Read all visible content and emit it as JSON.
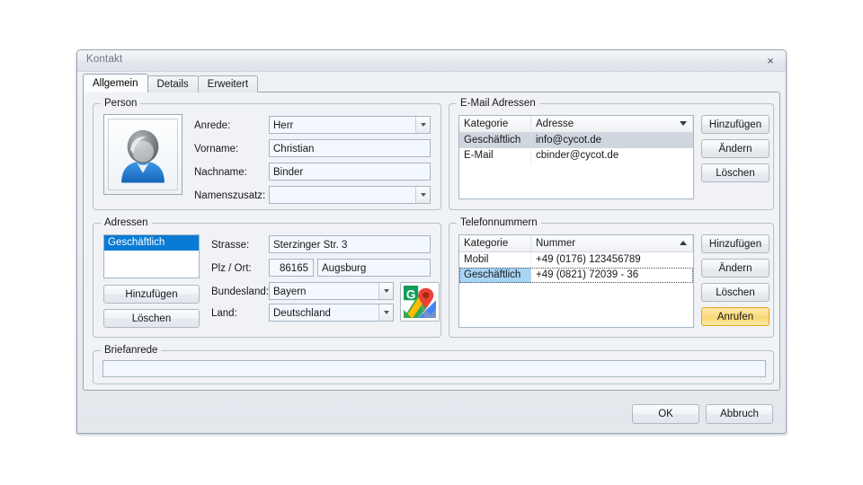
{
  "window": {
    "title": "Kontakt",
    "close_label": "×"
  },
  "tabs": [
    {
      "label": "Allgemein",
      "active": true
    },
    {
      "label": "Details",
      "active": false
    },
    {
      "label": "Erweitert",
      "active": false
    }
  ],
  "person": {
    "legend": "Person",
    "avatar_icon": "contact-avatar-icon",
    "fields": {
      "anrede_label": "Anrede:",
      "anrede_value": "Herr",
      "vorname_label": "Vorname:",
      "vorname_value": "Christian",
      "nachname_label": "Nachname:",
      "nachname_value": "Binder",
      "namenszusatz_label": "Namenszusatz:",
      "namenszusatz_value": ""
    }
  },
  "email": {
    "legend": "E-Mail Adressen",
    "columns": [
      "Kategorie",
      "Adresse"
    ],
    "sort": "desc",
    "rows": [
      {
        "kategorie": "Geschäftlich",
        "adresse": "info@cycot.de",
        "selected": "gray"
      },
      {
        "kategorie": "E-Mail",
        "adresse": "cbinder@cycot.de",
        "selected": "none"
      }
    ],
    "buttons": {
      "add": "Hinzufügen",
      "edit": "Ändern",
      "delete": "Löschen"
    }
  },
  "adressen": {
    "legend": "Adressen",
    "categories": [
      {
        "label": "Geschäftlich",
        "selected": true
      }
    ],
    "buttons": {
      "add": "Hinzufügen",
      "delete": "Löschen"
    },
    "fields": {
      "strasse_label": "Strasse:",
      "strasse_value": "Sterzinger Str. 3",
      "plz_ort_label": "Plz / Ort:",
      "plz_value": "86165",
      "ort_value": "Augsburg",
      "bundesland_label": "Bundesland:",
      "bundesland_value": "Bayern",
      "land_label": "Land:",
      "land_value": "Deutschland"
    },
    "maps_icon": "google-maps-icon"
  },
  "telefon": {
    "legend": "Telefonnummern",
    "columns": [
      "Kategorie",
      "Nummer"
    ],
    "sort": "asc",
    "rows": [
      {
        "kategorie": "Mobil",
        "nummer": "+49 (0176) 123456789",
        "selected": "none"
      },
      {
        "kategorie": "Geschäftlich",
        "nummer": "+49 (0821) 72039 - 36",
        "selected": "blue"
      }
    ],
    "buttons": {
      "add": "Hinzufügen",
      "edit": "Ändern",
      "delete": "Löschen",
      "call": "Anrufen"
    }
  },
  "briefanrede": {
    "legend": "Briefanrede",
    "value": "",
    "placeholder": ""
  },
  "footer": {
    "ok": "OK",
    "cancel": "Abbruch"
  },
  "colors": {
    "accent_selection": "#0a7bd4",
    "inactive_selection": "#cfd6de",
    "row_selection_blue": "#a8d4f5",
    "call_button": "#fbdc82",
    "call_button_border": "#e0a425",
    "field_bg": "#f2f8fe",
    "window_bg": "#f0f2f5"
  }
}
